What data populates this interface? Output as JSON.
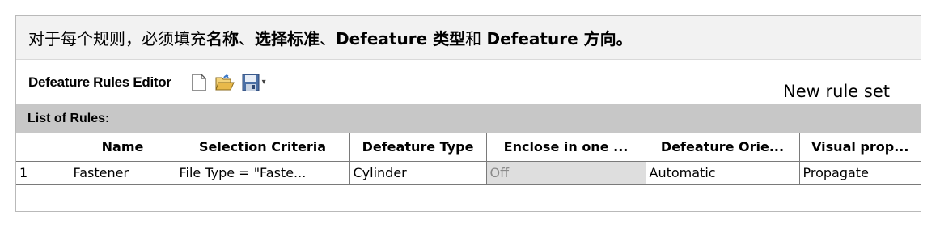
{
  "instruction": {
    "part1": "对于每个规则，必须填充",
    "name_term": "名称",
    "sep1": "、",
    "criteria_term": "选择标准",
    "sep2": "、",
    "type_term": "Defeature 类型",
    "and": "和",
    "direction_term": "Defeature 方向",
    "end": "。"
  },
  "toolbar": {
    "title": "Defeature Rules Editor",
    "new_icon": "new-file-icon",
    "open_icon": "open-folder-icon",
    "save_icon": "save-icon",
    "dropdown_arrow": "▾",
    "rule_set_name": "New rule set"
  },
  "list": {
    "header": "List of Rules:",
    "columns": [
      "",
      "Name",
      "Selection Criteria",
      "Defeature Type",
      "Enclose in one ...",
      "Defeature Orie...",
      "Visual prop..."
    ],
    "rows": [
      {
        "index": "1",
        "name": "Fastener",
        "selection_criteria": "File Type = \"Faste...",
        "defeature_type": "Cylinder",
        "enclose": "Off",
        "orientation": "Automatic",
        "visual": "Propagate"
      }
    ]
  }
}
